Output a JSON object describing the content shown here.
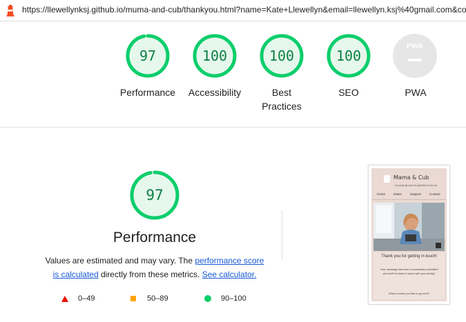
{
  "browser": {
    "url": "https://llewellynksj.github.io/muma-and-cub/thankyou.html?name=Kate+Llewellyn&email=llewellyn.ksj%40gmail.com&co",
    "icon": "lighthouse-icon"
  },
  "summary_gauges": [
    {
      "label": "Performance",
      "score": "97",
      "value": 97
    },
    {
      "label": "Accessibility",
      "score": "100",
      "value": 100
    },
    {
      "label": "Best Practices",
      "score": "100",
      "value": 100
    },
    {
      "label": "SEO",
      "score": "100",
      "value": 100
    }
  ],
  "pwa": {
    "badge_text": "PWA",
    "label": "PWA"
  },
  "performance": {
    "score": "97",
    "value": 97,
    "title": "Performance",
    "desc_pre": "Values are estimated and may vary. The ",
    "link_score_line1": "performance score",
    "link_score_line2": "is calculated",
    "desc_mid": " directly from these metrics. ",
    "link_calculator": "See calculator."
  },
  "legend": [
    {
      "shape": "triangle",
      "color": "#eb0f00",
      "text": "0–49"
    },
    {
      "shape": "square",
      "color": "#ffa400",
      "text": "50–89"
    },
    {
      "shape": "circle",
      "color": "#0cce6b",
      "text": "90–100"
    }
  ],
  "colors": {
    "pass": "#0cce6b",
    "pass_text": "#0b8043",
    "pass_bg": "#e6f7ec",
    "pwa_gray": "#e6e6e6"
  },
  "screenshot": {
    "site_title": "Mama & Cub",
    "tagline": "A social group for parents to-be an",
    "nav": [
      "Home",
      "Dates",
      "Support",
      "Contact"
    ],
    "thanks": "Thank you for getting in touch!",
    "message": "Your message has been successfully submitted and we'll be back in touch with you shortly!",
    "question": "Where would you like to go next?"
  }
}
